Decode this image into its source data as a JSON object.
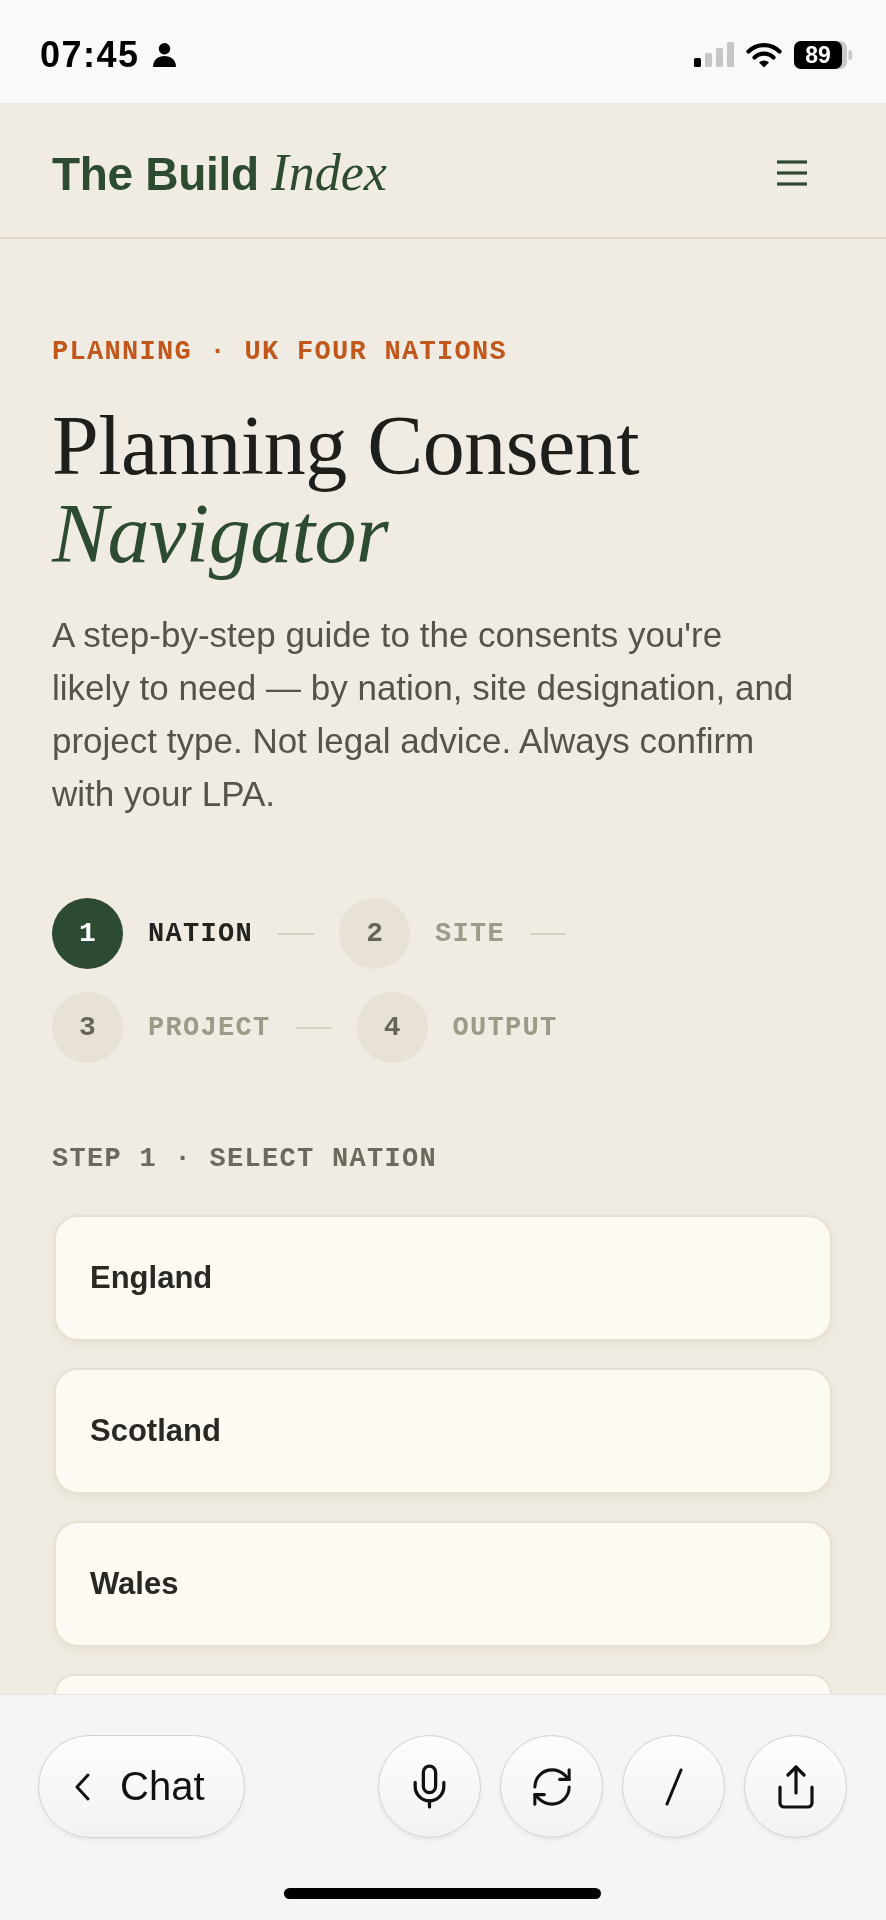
{
  "status_bar": {
    "time": "07:45",
    "battery": "89"
  },
  "header": {
    "logo": "The Build *Index*"
  },
  "hero": {
    "eyebrow": "PLANNING · UK FOUR NATIONS",
    "title": "Planning Consent *Navigator*",
    "description": "A step-by-step guide to the consents you're likely to need — by nation, site designation, and project type. Not legal advice. Always confirm with your LPA."
  },
  "stepper": [
    {
      "number": "1",
      "label": "NATION",
      "selected": true
    },
    {
      "number": "2",
      "label": "SITE",
      "selected": false
    },
    {
      "number": "3",
      "label": "PROJECT",
      "selected": false
    },
    {
      "number": "4",
      "label": "OUTPUT",
      "selected": false
    }
  ],
  "step_section": {
    "heading": "STEP 1 · SELECT NATION",
    "options": [
      {
        "label": "England"
      },
      {
        "label": "Scotland"
      },
      {
        "label": "Wales"
      }
    ],
    "more_below": true
  },
  "bottom_bar": {
    "back_button": "Chat"
  }
}
